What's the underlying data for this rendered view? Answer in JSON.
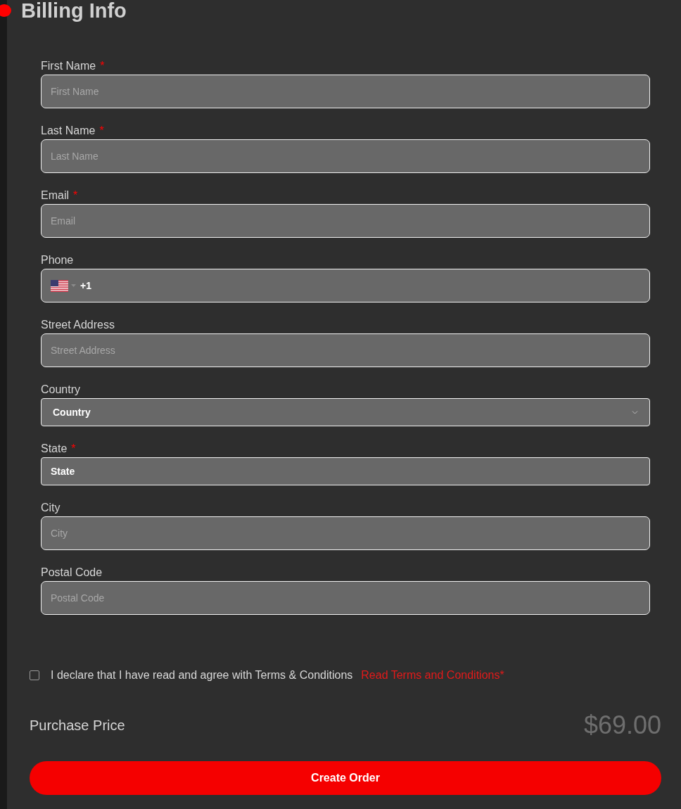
{
  "heading": "Billing Info",
  "fields": [
    {
      "kind": "text",
      "label": "First Name",
      "required": true,
      "placeholder": "First Name"
    },
    {
      "kind": "text",
      "label": "Last Name",
      "required": true,
      "placeholder": "Last Name"
    },
    {
      "kind": "text",
      "label": "Email",
      "required": true,
      "placeholder": "Email"
    },
    {
      "kind": "phone",
      "label": "Phone",
      "required": false,
      "value": "+1"
    },
    {
      "kind": "text",
      "label": "Street Address",
      "required": false,
      "placeholder": "Street Address"
    },
    {
      "kind": "select",
      "label": "Country",
      "required": false,
      "value": "Country"
    },
    {
      "kind": "picker",
      "label": "State",
      "required": true,
      "value": "State"
    },
    {
      "kind": "text",
      "label": "City",
      "required": false,
      "placeholder": "City"
    },
    {
      "kind": "text",
      "label": "Postal Code",
      "required": false,
      "placeholder": "Postal Code"
    }
  ],
  "required_mark": "*",
  "terms": {
    "checked": false,
    "text": "I declare that I have read and agree with Terms & Conditions",
    "link": "Read Terms and Conditions*"
  },
  "price": {
    "label": "Purchase Price",
    "amount": "$69.00"
  },
  "submit": "Create Order"
}
